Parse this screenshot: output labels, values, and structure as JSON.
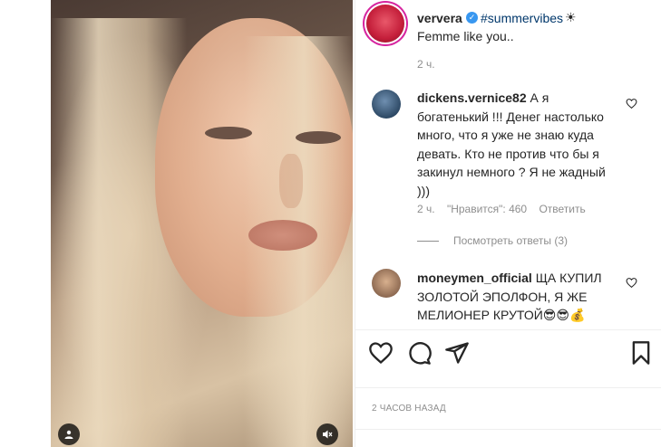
{
  "header": {
    "username": "ververa",
    "verified_mark": "✓",
    "hashtag": "#summervibes",
    "sun_emoji": "☀",
    "caption": "Femme like you..",
    "time": "2 ч."
  },
  "comments": [
    {
      "username": "dickens.vernice82",
      "text": "А я богатенький !!! Денег настолько много, что я уже не знаю куда девать. Кто не против что бы я закинул немного ? Я не жадный )))",
      "time": "2 ч.",
      "likes": "\"Нравится\": 460",
      "reply": "Ответить",
      "view_replies": "Посмотреть ответы (3)"
    },
    {
      "username": "moneymen_official",
      "text": "ЩА КУПИЛ ЗОЛОТОЙ ЭПОЛФОН, Я ЖЕ МЕЛИОНЕР КРУТОЙ😎😎💰"
    }
  ],
  "post_date": "2 ЧАСОВ НАЗАД",
  "icons": {
    "like": "heart-icon",
    "comment": "comment-icon",
    "share": "share-icon",
    "save": "bookmark-icon",
    "comment_like": "heart-icon"
  },
  "colors": {
    "text": "#262626",
    "secondary": "#8e8e8e",
    "link": "#00376b",
    "verified": "#3897f0",
    "divider": "#efefef"
  }
}
